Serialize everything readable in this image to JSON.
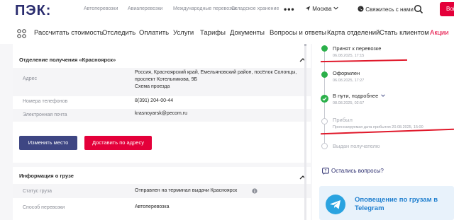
{
  "header": {
    "logo": "ПЭК:",
    "nav": [
      "Автоперевозки",
      "Авиаперевозки",
      "Международные перевозки",
      "Складское хранение"
    ],
    "more": "•••",
    "city": "Москва",
    "contact": "Свяжитесь с нами",
    "login": "Войти"
  },
  "mainnav": {
    "items": [
      "Рассчитать стоимость",
      "Отследить",
      "Оплатить",
      "Услуги",
      "Тарифы",
      "Документы",
      "Вопросы и ответы",
      "Карта отделений",
      "Стать клиентом"
    ],
    "promo": "Акции"
  },
  "office": {
    "title": "Отделение получения «Красноярск»",
    "address_label": "Адрес",
    "address_lines": [
      "Россия, Красноярский край, Емельяновский район, посёлок Солонцы,",
      "проспект Котельникова, 9Б"
    ],
    "map_link": "Схема проезда",
    "phones_label": "Номера телефонов",
    "phones": "8(391) 204-00-44",
    "email_label": "Электронная почта",
    "email": "krasnoyarsk@pecom.ru",
    "change_button": "Изменить место",
    "deliver_button": "Доставить по адресу"
  },
  "cargo": {
    "title": "Информация о грузе",
    "status_label": "Статус груза",
    "status_value": "Отправлен на терминал выдачи Красноярск",
    "method_label": "Способ перевозки",
    "method_value": "Автоперевозка"
  },
  "timeline": [
    {
      "title": "Принят к перевозке",
      "date": "06.08.2025, 17:15",
      "done": true
    },
    {
      "title": "Оформлен",
      "date": "06.08.2025, 17:27",
      "done": true
    },
    {
      "title": "В пути, подробнее",
      "date": "08.08.2025, 02:57",
      "done": true
    },
    {
      "title": "Прибыл",
      "date": "Прогнозируемая дата прибытия 20.08.2025, 15:00",
      "done": false
    },
    {
      "title": "Выдан получателю",
      "date": "",
      "done": false
    }
  ],
  "sidebar": {
    "question": "Остались вопросы?",
    "telegram": "Оповещение по грузам в Telegram"
  },
  "colors": {
    "brand_red": "#e4003a",
    "brand_blue": "#3e4683",
    "status_green": "#2bb04a"
  }
}
